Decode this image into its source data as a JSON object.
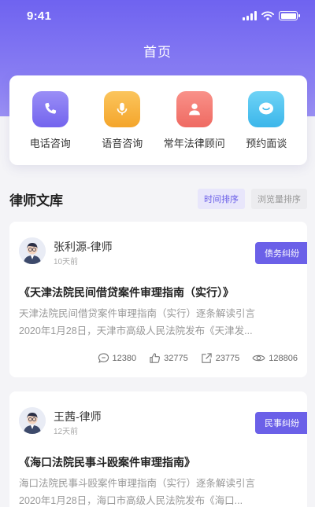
{
  "status_bar": {
    "time": "9:41"
  },
  "nav": {
    "title": "首页"
  },
  "services": [
    {
      "label": "电话咨询",
      "icon": "phone-icon",
      "color": "#7f6ff0"
    },
    {
      "label": "语音咨询",
      "icon": "microphone-icon",
      "color": "#f6b13e"
    },
    {
      "label": "常年法律顾问",
      "icon": "person-icon",
      "color": "#f37a72"
    },
    {
      "label": "预约面谈",
      "icon": "chat-bubble-icon",
      "color": "#4ec3ee"
    }
  ],
  "library": {
    "title": "律师文库",
    "sort_time": "时间排序",
    "sort_views": "浏览量排序"
  },
  "articles": [
    {
      "lawyer": "张利源-律师",
      "time": "10天前",
      "tag": "债务纠纷",
      "title": "《天津法院民间借贷案件审理指南（实行）》",
      "summary_line1": "天津法院民间借贷案件审理指南（实行）逐条解读引言",
      "summary_line2": "2020年1月28日，天津市高级人民法院发布《天津发...",
      "comments": "12380",
      "likes": "32775",
      "shares": "23775",
      "views": "128806"
    },
    {
      "lawyer": "王茜-律师",
      "time": "12天前",
      "tag": "民事纠纷",
      "title": "《海口法院民事斗殴案件审理指南》",
      "summary_line1": "海口法院民事斗殴案件审理指南（实行）逐条解读引言",
      "summary_line2": "2020年1月28日，海口市高级人民法院发布《海口..."
    }
  ],
  "colors": {
    "accent": "#6b60e8",
    "hero": "#7a6ef1"
  }
}
